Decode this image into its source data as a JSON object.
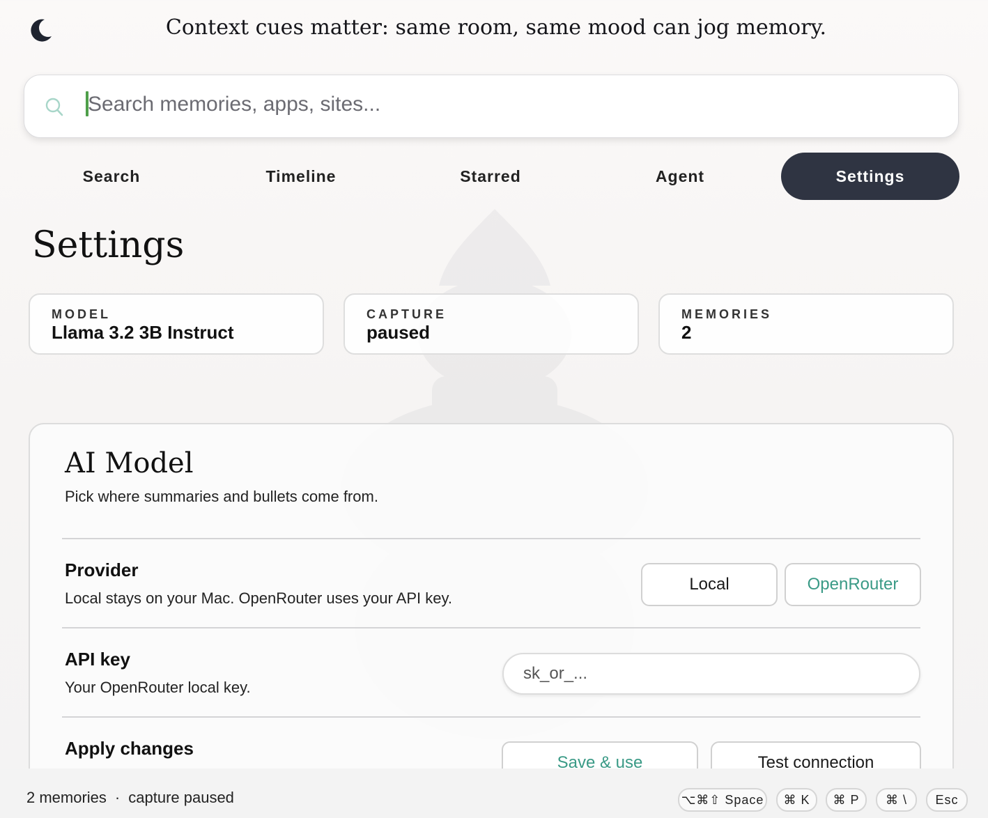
{
  "header": {
    "theme_icon": "moon-icon",
    "tip": "Context cues matter: same room, same mood can jog memory."
  },
  "search": {
    "placeholder": "Search memories, apps, sites...",
    "icon": "search-icon"
  },
  "tabs": [
    {
      "label": "Search",
      "active": false
    },
    {
      "label": "Timeline",
      "active": false
    },
    {
      "label": "Starred",
      "active": false
    },
    {
      "label": "Agent",
      "active": false
    },
    {
      "label": "Settings",
      "active": true
    }
  ],
  "page": {
    "title": "Settings"
  },
  "stats": [
    {
      "label": "MODEL",
      "value": "Llama 3.2 3B Instruct"
    },
    {
      "label": "CAPTURE",
      "value": "paused"
    },
    {
      "label": "MEMORIES",
      "value": "2"
    }
  ],
  "ai_model": {
    "title": "AI Model",
    "subtitle": "Pick where summaries and bullets come from.",
    "provider": {
      "title": "Provider",
      "description": "Local stays on your Mac. OpenRouter uses your API key.",
      "options": [
        "Local",
        "OpenRouter"
      ],
      "selected": "OpenRouter"
    },
    "api_key": {
      "title": "API key",
      "description": "Your OpenRouter local key.",
      "placeholder": "sk_or_..."
    },
    "apply": {
      "title": "Apply changes",
      "save_label": "Save & use",
      "test_label": "Test connection"
    }
  },
  "footer": {
    "memories": "2 memories",
    "separator": "·",
    "capture": "capture paused",
    "shortcuts": [
      "⌥⌘⇧ Space",
      "⌘ K",
      "⌘ P",
      "⌘ \\",
      "Esc"
    ]
  },
  "colors": {
    "accent": "#3a9a86",
    "active_tab": "#2f3442",
    "caret": "#4f9f4a"
  }
}
